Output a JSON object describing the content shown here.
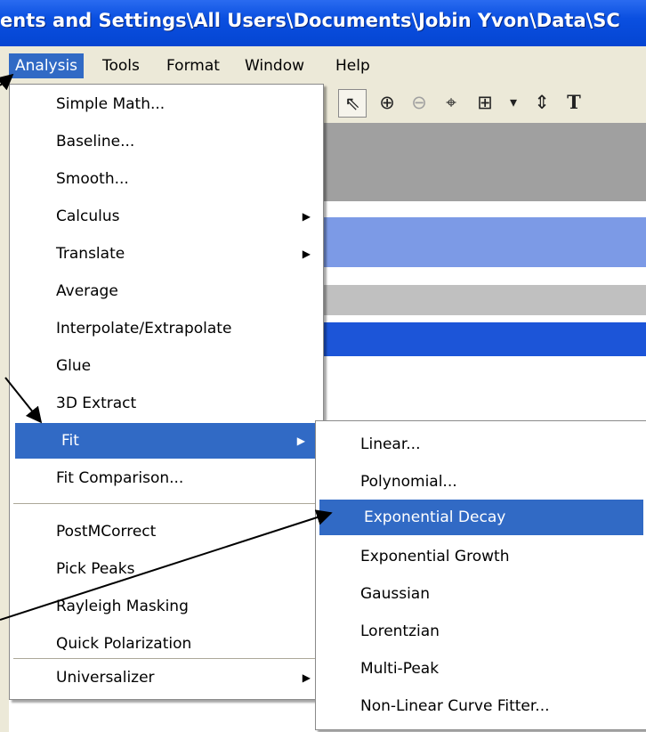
{
  "window": {
    "title": "ents and Settings\\All Users\\Documents\\Jobin Yvon\\Data\\SC"
  },
  "menubar": {
    "items": [
      "Analysis",
      "Tools",
      "Format",
      "Window",
      "Help"
    ],
    "active": "Analysis"
  },
  "toolbar": {
    "icons": [
      "pointer-icon",
      "zoom-in-icon",
      "zoom-out-icon",
      "crosshair-icon",
      "data-selector-icon",
      "dropdown-arrow-icon",
      "vertical-arrows-icon",
      "text-tool-icon"
    ],
    "glyphs": {
      "pointer": "⇖",
      "zoom_in": "⊕",
      "zoom_out": "⊖",
      "crosshair": "⌖",
      "selector": "⊞",
      "dropdown": "▾",
      "vertical": "⇕",
      "text": "T"
    }
  },
  "analysis_menu": {
    "items": [
      {
        "label": "Simple Math...",
        "submenu": false
      },
      {
        "label": "Baseline...",
        "submenu": false
      },
      {
        "label": "Smooth...",
        "submenu": false
      },
      {
        "label": "Calculus",
        "submenu": true
      },
      {
        "label": "Translate",
        "submenu": true
      },
      {
        "label": "Average",
        "submenu": false
      },
      {
        "label": "Interpolate/Extrapolate",
        "submenu": false
      },
      {
        "label": "Glue",
        "submenu": false
      },
      {
        "label": "3D Extract",
        "submenu": false
      },
      {
        "label": "Fit",
        "submenu": true,
        "highlighted": true
      },
      {
        "label": "Fit Comparison...",
        "submenu": false
      },
      {
        "label": "PostMCorrect",
        "submenu": false
      },
      {
        "label": "Pick Peaks",
        "submenu": false
      },
      {
        "label": "Rayleigh Masking",
        "submenu": false
      },
      {
        "label": "Quick Polarization",
        "submenu": false
      },
      {
        "label": "Universalizer",
        "submenu": true
      }
    ]
  },
  "fit_submenu": {
    "items": [
      {
        "label": "Linear..."
      },
      {
        "label": "Polynomial..."
      },
      {
        "label": "Exponential Decay",
        "highlighted": true
      },
      {
        "label": "Exponential Growth"
      },
      {
        "label": "Gaussian"
      },
      {
        "label": "Lorentzian"
      },
      {
        "label": "Multi-Peak"
      },
      {
        "label": "Non-Linear Curve Fitter..."
      }
    ]
  },
  "colors": {
    "titlebar": "#0a4fe0",
    "menu_highlight": "#316ac5",
    "menu_background": "#ece9d8",
    "annotation_arrow": "#000000"
  }
}
